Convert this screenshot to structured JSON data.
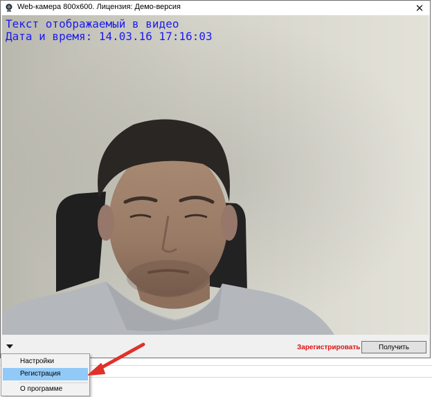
{
  "window": {
    "title": "Web-камера 800x600. Лицензия: Демо-версия",
    "close_glyph": "✕"
  },
  "video": {
    "overlay_text": "Текст отображаемый в видео",
    "overlay_datetime": "Дата и время: 14.03.16 17:16:03",
    "overlay_color": "#1a1af0"
  },
  "bottom_bar": {
    "register_label": "Зарегистрировать",
    "get_label": "Получить",
    "register_color": "#e01010"
  },
  "menu": {
    "items": [
      {
        "label": "Настройки"
      },
      {
        "label": "Регистрация",
        "highlighted": true
      },
      {
        "label": "О программе"
      }
    ],
    "highlight_color": "#91c9f7"
  },
  "annotation": {
    "arrow_color": "#e0312a",
    "points_to": "Регистрация"
  }
}
